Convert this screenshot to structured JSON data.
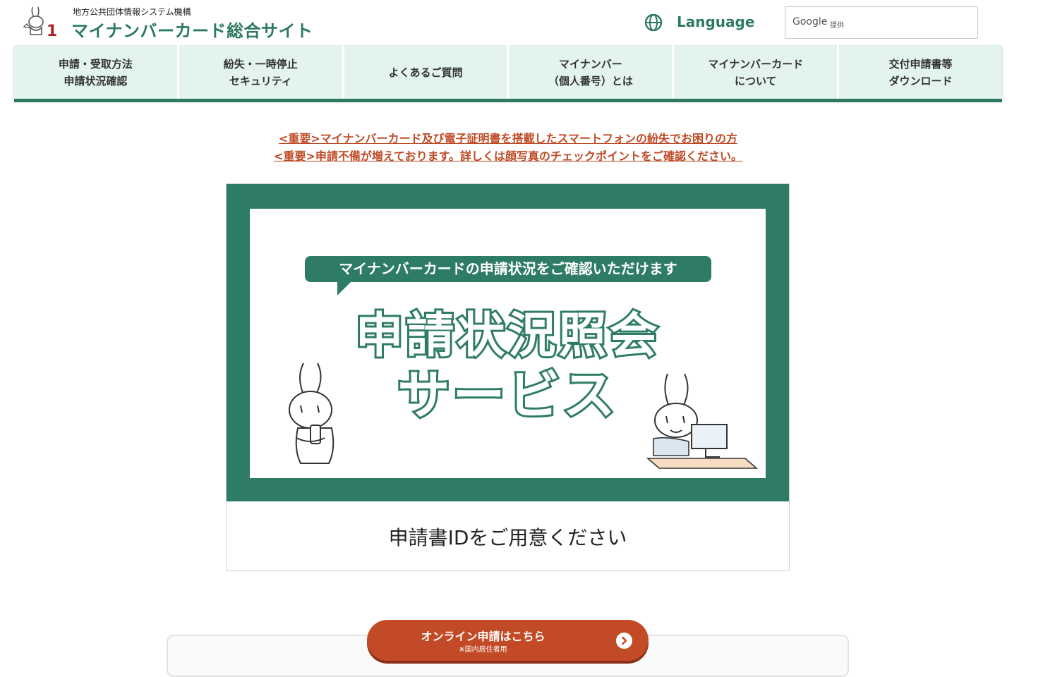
{
  "header": {
    "org_name": "地方公共団体情報システム機構",
    "site_title": "マイナンバーカード総合サイト",
    "language_label": "Language",
    "translate_google": "Google",
    "translate_provided": "提供"
  },
  "nav": [
    {
      "line1": "申請・受取方法",
      "line2": "申請状況確認"
    },
    {
      "line1": "紛失・一時停止",
      "line2": "セキュリティ"
    },
    {
      "line1": "よくあるご質問",
      "line2": ""
    },
    {
      "line1": "マイナンバー",
      "line2": "（個人番号）とは"
    },
    {
      "line1": "マイナンバーカード",
      "line2": "について"
    },
    {
      "line1": "交付申請書等",
      "line2": "ダウンロード"
    }
  ],
  "notices": [
    "<重要>マイナンバーカード及び電子証明書を搭載したスマートフォンの紛失でお困りの方",
    "<重要>申請不備が増えております。詳しくは顔写真のチェックポイントをご確認ください。"
  ],
  "banner": {
    "bubble": "マイナンバーカードの申請状況をご確認いただけます",
    "title_line1": "申請状況照会",
    "title_line2": "サービス",
    "caption": "申請書IDをご用意ください"
  },
  "cta": {
    "main": "オンライン申請はこちら",
    "sub": "※国内居住者用"
  },
  "colors": {
    "brand_green": "#2d7a62",
    "nav_bg": "#e3f4ef",
    "notice_red": "#c04a25",
    "cta_red": "#c24a26"
  }
}
